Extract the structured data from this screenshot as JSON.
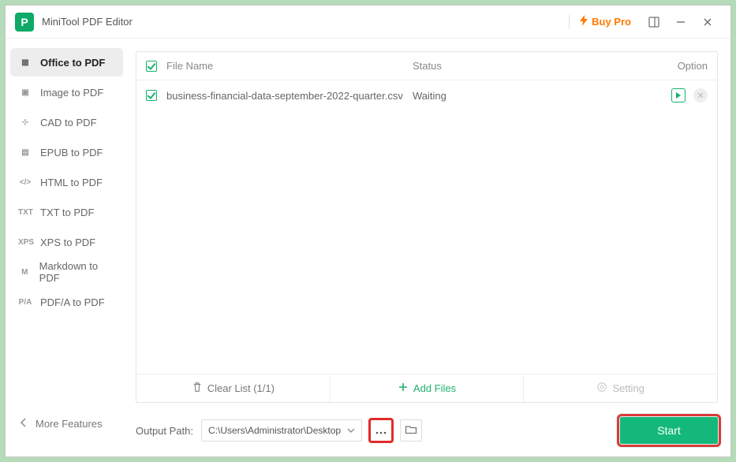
{
  "app": {
    "title": "MiniTool PDF Editor",
    "buy_pro": "Buy Pro"
  },
  "sidebar": {
    "items": [
      {
        "glyph": "▦",
        "label": "Office to PDF",
        "active": true
      },
      {
        "glyph": "▣",
        "label": "Image to PDF",
        "active": false
      },
      {
        "glyph": "⊹",
        "label": "CAD to PDF",
        "active": false
      },
      {
        "glyph": "▤",
        "label": "EPUB to PDF",
        "active": false
      },
      {
        "glyph": "</>",
        "label": "HTML to PDF",
        "active": false
      },
      {
        "glyph": "TXT",
        "label": "TXT to PDF",
        "active": false
      },
      {
        "glyph": "XPS",
        "label": "XPS to PDF",
        "active": false
      },
      {
        "glyph": "M",
        "label": "Markdown to PDF",
        "active": false
      },
      {
        "glyph": "P/A",
        "label": "PDF/A to PDF",
        "active": false
      }
    ],
    "more": "More Features"
  },
  "list": {
    "headers": {
      "name": "File Name",
      "status": "Status",
      "option": "Option"
    },
    "rows": [
      {
        "name": "business-financial-data-september-2022-quarter.csv",
        "status": "Waiting"
      }
    ],
    "clear": "Clear List (1/1)",
    "add": "Add Files",
    "setting": "Setting"
  },
  "footer": {
    "output_label": "Output Path:",
    "path": "C:\\Users\\Administrator\\Desktop",
    "start": "Start"
  }
}
